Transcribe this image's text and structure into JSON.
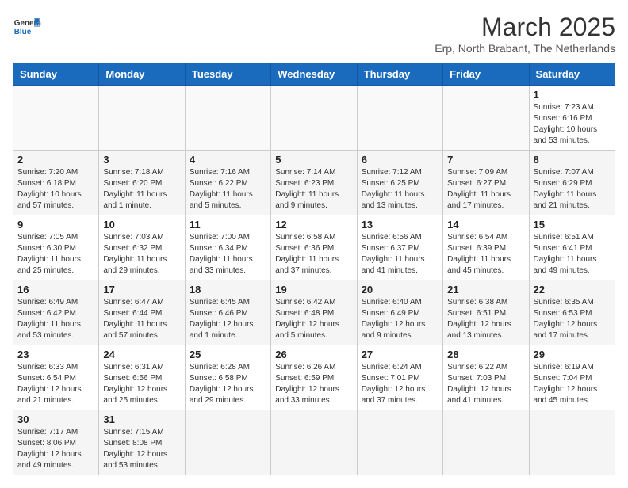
{
  "header": {
    "logo_general": "General",
    "logo_blue": "Blue",
    "month_title": "March 2025",
    "subtitle": "Erp, North Brabant, The Netherlands"
  },
  "days_of_week": [
    "Sunday",
    "Monday",
    "Tuesday",
    "Wednesday",
    "Thursday",
    "Friday",
    "Saturday"
  ],
  "weeks": [
    [
      null,
      null,
      null,
      null,
      null,
      null,
      {
        "num": "1",
        "sunrise": "Sunrise: 7:23 AM",
        "sunset": "Sunset: 6:16 PM",
        "daylight": "Daylight: 10 hours and 53 minutes."
      }
    ],
    [
      {
        "num": "2",
        "sunrise": "Sunrise: 7:20 AM",
        "sunset": "Sunset: 6:18 PM",
        "daylight": "Daylight: 10 hours and 57 minutes."
      },
      {
        "num": "3",
        "sunrise": "Sunrise: 7:18 AM",
        "sunset": "Sunset: 6:20 PM",
        "daylight": "Daylight: 11 hours and 1 minute."
      },
      {
        "num": "4",
        "sunrise": "Sunrise: 7:16 AM",
        "sunset": "Sunset: 6:22 PM",
        "daylight": "Daylight: 11 hours and 5 minutes."
      },
      {
        "num": "5",
        "sunrise": "Sunrise: 7:14 AM",
        "sunset": "Sunset: 6:23 PM",
        "daylight": "Daylight: 11 hours and 9 minutes."
      },
      {
        "num": "6",
        "sunrise": "Sunrise: 7:12 AM",
        "sunset": "Sunset: 6:25 PM",
        "daylight": "Daylight: 11 hours and 13 minutes."
      },
      {
        "num": "7",
        "sunrise": "Sunrise: 7:09 AM",
        "sunset": "Sunset: 6:27 PM",
        "daylight": "Daylight: 11 hours and 17 minutes."
      },
      {
        "num": "8",
        "sunrise": "Sunrise: 7:07 AM",
        "sunset": "Sunset: 6:29 PM",
        "daylight": "Daylight: 11 hours and 21 minutes."
      }
    ],
    [
      {
        "num": "9",
        "sunrise": "Sunrise: 7:05 AM",
        "sunset": "Sunset: 6:30 PM",
        "daylight": "Daylight: 11 hours and 25 minutes."
      },
      {
        "num": "10",
        "sunrise": "Sunrise: 7:03 AM",
        "sunset": "Sunset: 6:32 PM",
        "daylight": "Daylight: 11 hours and 29 minutes."
      },
      {
        "num": "11",
        "sunrise": "Sunrise: 7:00 AM",
        "sunset": "Sunset: 6:34 PM",
        "daylight": "Daylight: 11 hours and 33 minutes."
      },
      {
        "num": "12",
        "sunrise": "Sunrise: 6:58 AM",
        "sunset": "Sunset: 6:36 PM",
        "daylight": "Daylight: 11 hours and 37 minutes."
      },
      {
        "num": "13",
        "sunrise": "Sunrise: 6:56 AM",
        "sunset": "Sunset: 6:37 PM",
        "daylight": "Daylight: 11 hours and 41 minutes."
      },
      {
        "num": "14",
        "sunrise": "Sunrise: 6:54 AM",
        "sunset": "Sunset: 6:39 PM",
        "daylight": "Daylight: 11 hours and 45 minutes."
      },
      {
        "num": "15",
        "sunrise": "Sunrise: 6:51 AM",
        "sunset": "Sunset: 6:41 PM",
        "daylight": "Daylight: 11 hours and 49 minutes."
      }
    ],
    [
      {
        "num": "16",
        "sunrise": "Sunrise: 6:49 AM",
        "sunset": "Sunset: 6:42 PM",
        "daylight": "Daylight: 11 hours and 53 minutes."
      },
      {
        "num": "17",
        "sunrise": "Sunrise: 6:47 AM",
        "sunset": "Sunset: 6:44 PM",
        "daylight": "Daylight: 11 hours and 57 minutes."
      },
      {
        "num": "18",
        "sunrise": "Sunrise: 6:45 AM",
        "sunset": "Sunset: 6:46 PM",
        "daylight": "Daylight: 12 hours and 1 minute."
      },
      {
        "num": "19",
        "sunrise": "Sunrise: 6:42 AM",
        "sunset": "Sunset: 6:48 PM",
        "daylight": "Daylight: 12 hours and 5 minutes."
      },
      {
        "num": "20",
        "sunrise": "Sunrise: 6:40 AM",
        "sunset": "Sunset: 6:49 PM",
        "daylight": "Daylight: 12 hours and 9 minutes."
      },
      {
        "num": "21",
        "sunrise": "Sunrise: 6:38 AM",
        "sunset": "Sunset: 6:51 PM",
        "daylight": "Daylight: 12 hours and 13 minutes."
      },
      {
        "num": "22",
        "sunrise": "Sunrise: 6:35 AM",
        "sunset": "Sunset: 6:53 PM",
        "daylight": "Daylight: 12 hours and 17 minutes."
      }
    ],
    [
      {
        "num": "23",
        "sunrise": "Sunrise: 6:33 AM",
        "sunset": "Sunset: 6:54 PM",
        "daylight": "Daylight: 12 hours and 21 minutes."
      },
      {
        "num": "24",
        "sunrise": "Sunrise: 6:31 AM",
        "sunset": "Sunset: 6:56 PM",
        "daylight": "Daylight: 12 hours and 25 minutes."
      },
      {
        "num": "25",
        "sunrise": "Sunrise: 6:28 AM",
        "sunset": "Sunset: 6:58 PM",
        "daylight": "Daylight: 12 hours and 29 minutes."
      },
      {
        "num": "26",
        "sunrise": "Sunrise: 6:26 AM",
        "sunset": "Sunset: 6:59 PM",
        "daylight": "Daylight: 12 hours and 33 minutes."
      },
      {
        "num": "27",
        "sunrise": "Sunrise: 6:24 AM",
        "sunset": "Sunset: 7:01 PM",
        "daylight": "Daylight: 12 hours and 37 minutes."
      },
      {
        "num": "28",
        "sunrise": "Sunrise: 6:22 AM",
        "sunset": "Sunset: 7:03 PM",
        "daylight": "Daylight: 12 hours and 41 minutes."
      },
      {
        "num": "29",
        "sunrise": "Sunrise: 6:19 AM",
        "sunset": "Sunset: 7:04 PM",
        "daylight": "Daylight: 12 hours and 45 minutes."
      }
    ],
    [
      {
        "num": "30",
        "sunrise": "Sunrise: 7:17 AM",
        "sunset": "Sunset: 8:06 PM",
        "daylight": "Daylight: 12 hours and 49 minutes."
      },
      {
        "num": "31",
        "sunrise": "Sunrise: 7:15 AM",
        "sunset": "Sunset: 8:08 PM",
        "daylight": "Daylight: 12 hours and 53 minutes."
      },
      null,
      null,
      null,
      null,
      null
    ]
  ]
}
